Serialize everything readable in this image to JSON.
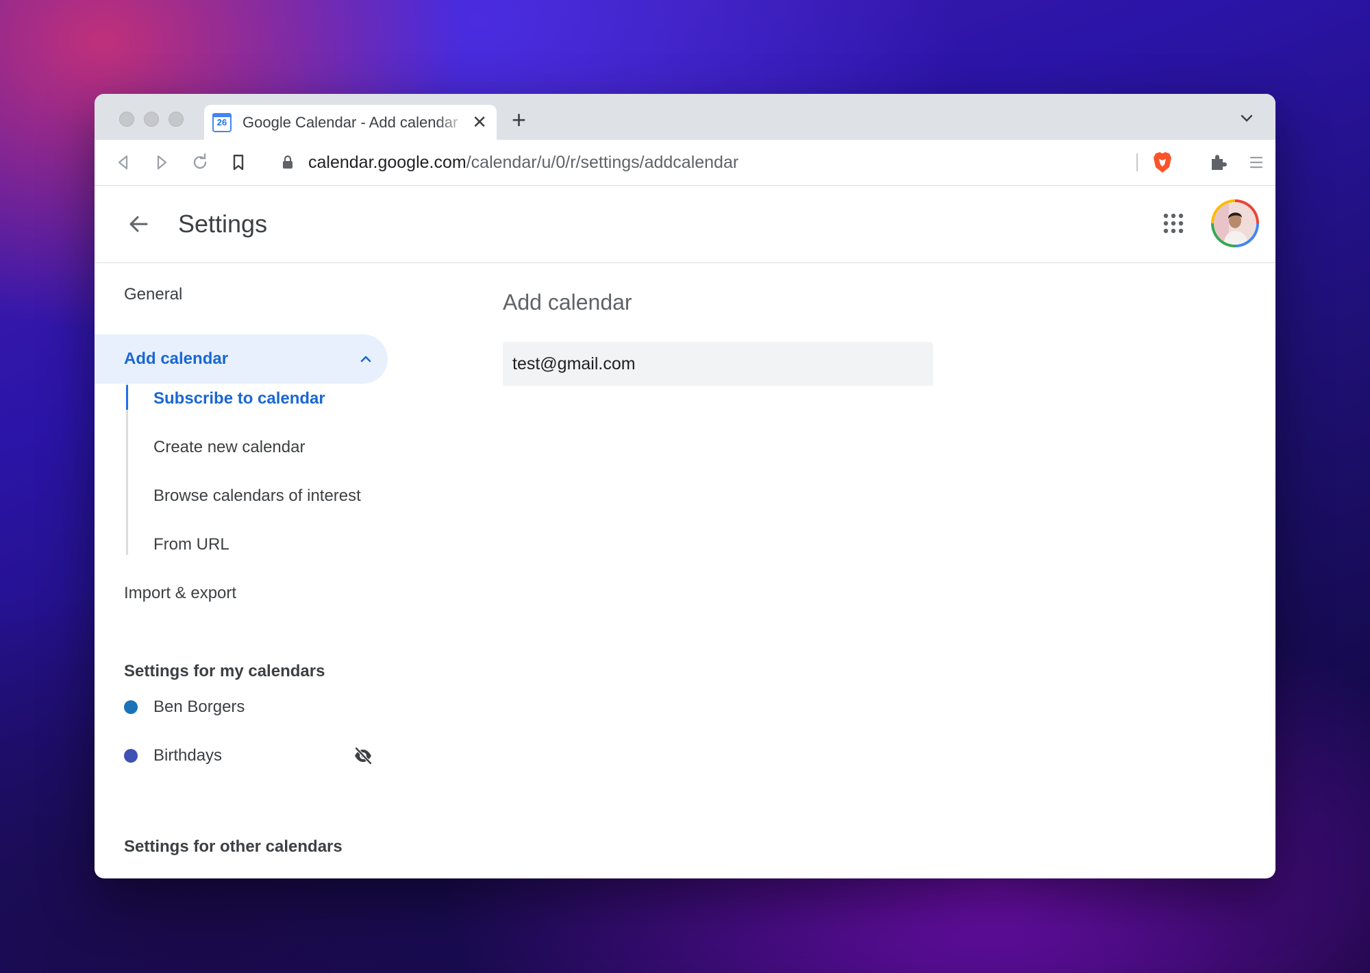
{
  "browser": {
    "tab_title": "Google Calendar - Add calendar",
    "favicon_text": "26",
    "url_host": "calendar.google.com",
    "url_path": "/calendar/u/0/r/settings/addcalendar"
  },
  "header": {
    "title": "Settings"
  },
  "sidebar": {
    "general": "General",
    "add_calendar": "Add calendar",
    "sub_items": [
      "Subscribe to calendar",
      "Create new calendar",
      "Browse calendars of interest",
      "From URL"
    ],
    "import_export": "Import & export",
    "my_calendars_heading": "Settings for my calendars",
    "my_calendars": [
      {
        "name": "Ben Borgers",
        "color": "#1a73b8"
      },
      {
        "name": "Birthdays",
        "color": "#3f51b5"
      }
    ],
    "other_calendars_heading": "Settings for other calendars"
  },
  "main": {
    "title": "Add calendar",
    "email_value": "test@gmail.com"
  },
  "colors": {
    "accent": "#1967d2",
    "active_bg": "#e8f0fe"
  }
}
